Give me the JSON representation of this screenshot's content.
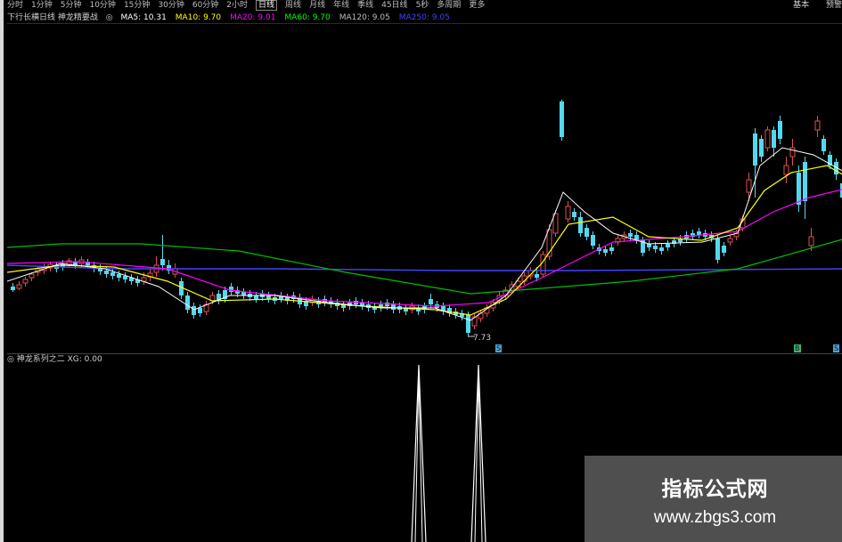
{
  "period_bar": {
    "items": [
      "分时",
      "1分钟",
      "5分钟",
      "10分钟",
      "15分钟",
      "30分钟",
      "60分钟",
      "2小时",
      "日线",
      "周线",
      "月线",
      "年线",
      "季线",
      "45日线",
      "5秒",
      "多周期",
      "更多"
    ],
    "active": "日线",
    "right": [
      "基本",
      "预警"
    ]
  },
  "ma_bar": {
    "stock_title": "下行长横日线 神龙精要战",
    "items": [
      {
        "label": "MA5: 10.31",
        "color": "#ffffff"
      },
      {
        "label": "MA10: 9.70",
        "color": "#ffff00"
      },
      {
        "label": "MA20: 9.01",
        "color": "#ff00ff"
      },
      {
        "label": "MA60: 9.70",
        "color": "#00ff00"
      },
      {
        "label": "MA120: 9.05",
        "color": "#bbbbbb"
      },
      {
        "label": "MA250: 9.05",
        "color": "#4040ff"
      }
    ]
  },
  "main_chart": {
    "low_label": "7.73",
    "colors": {
      "up": "#e0504f",
      "down": "#54d8f0",
      "ma5": "#ffffff",
      "ma10": "#ffff00",
      "ma20": "#ff00ff",
      "ma60": "#00c000",
      "ma250": "#4444ff"
    }
  },
  "sub_chart": {
    "label": "神龙系列之二 XG: 0.00"
  },
  "watermark": {
    "title": "指标公式网",
    "url": "www.zbgs3.com"
  }
}
